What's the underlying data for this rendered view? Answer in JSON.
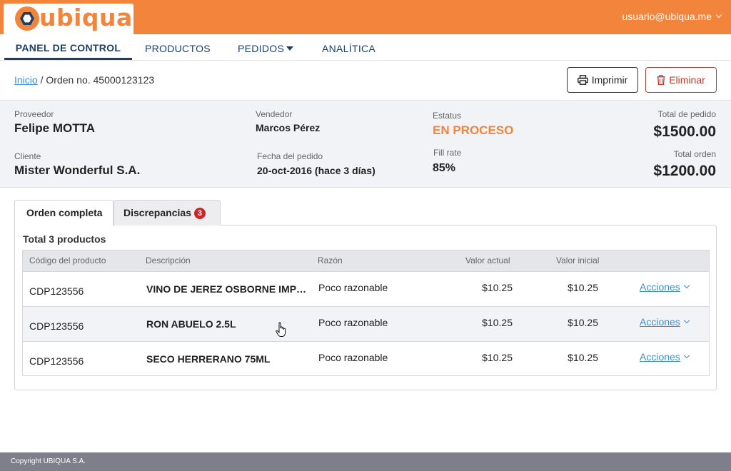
{
  "brand": {
    "logo_text": "ubiqua",
    "accent": "#f2843c",
    "navy": "#1d3f66"
  },
  "user": {
    "email": "usuario@ubiqua.me"
  },
  "nav": {
    "items": [
      {
        "label": "PANEL DE CONTROL",
        "active": true
      },
      {
        "label": "PRODUCTOS"
      },
      {
        "label": "PEDIDOS",
        "has_dropdown": true
      },
      {
        "label": "ANALÍTICA"
      }
    ]
  },
  "breadcrumb": {
    "home": "Inicio",
    "separator": "/",
    "current": "Orden no. 45000123123"
  },
  "actions": {
    "print": "Imprimir",
    "delete": "Eliminar"
  },
  "summary": {
    "proveedor_label": "Proveedor",
    "proveedor": "Felipe MOTTA",
    "cliente_label": "Cliente",
    "cliente": "Mister Wonderful S.A.",
    "vendedor_label": "Vendedor",
    "vendedor": "Marcos Pérez",
    "fecha_label": "Fecha del pedido",
    "fecha": "20-oct-2016 (hace 3 días)",
    "estatus_label": "Estatus",
    "estatus": "EN PROCESO",
    "fill_rate_label": "Fill rate",
    "fill_rate": "85%",
    "total_pedido_label": "Total de pedido",
    "total_pedido": "$1500.00",
    "total_orden_label": "Total orden",
    "total_orden": "$1200.00"
  },
  "tabs": [
    {
      "label": "Orden completa",
      "active": true
    },
    {
      "label": "Discrepancias",
      "badge": "3"
    }
  ],
  "table": {
    "total_label": "Total 3 productos",
    "headers": [
      "Código del producto",
      "Descripción",
      "Razón",
      "Valor actual",
      "Valor inicial"
    ],
    "rows": [
      {
        "code": "CDP123556",
        "desc": "VINO DE JEREZ OSBORNE IMPERIAL",
        "reason": "Poco razonable",
        "current": "$10.25",
        "initial": "$10.25",
        "action": "Acciones"
      },
      {
        "code": "CDP123556",
        "desc": "RON ABUELO 2.5L",
        "reason": "Poco razonable",
        "current": "$10.25",
        "initial": "$10.25",
        "action": "Acciones"
      },
      {
        "code": "CDP123556",
        "desc": "SECO HERRERANO 75ML",
        "reason": "Poco razonable",
        "current": "$10.25",
        "initial": "$10.25",
        "action": "Acciones"
      }
    ]
  },
  "footer": {
    "copyright": "Copyright UBIQUA S.A."
  }
}
